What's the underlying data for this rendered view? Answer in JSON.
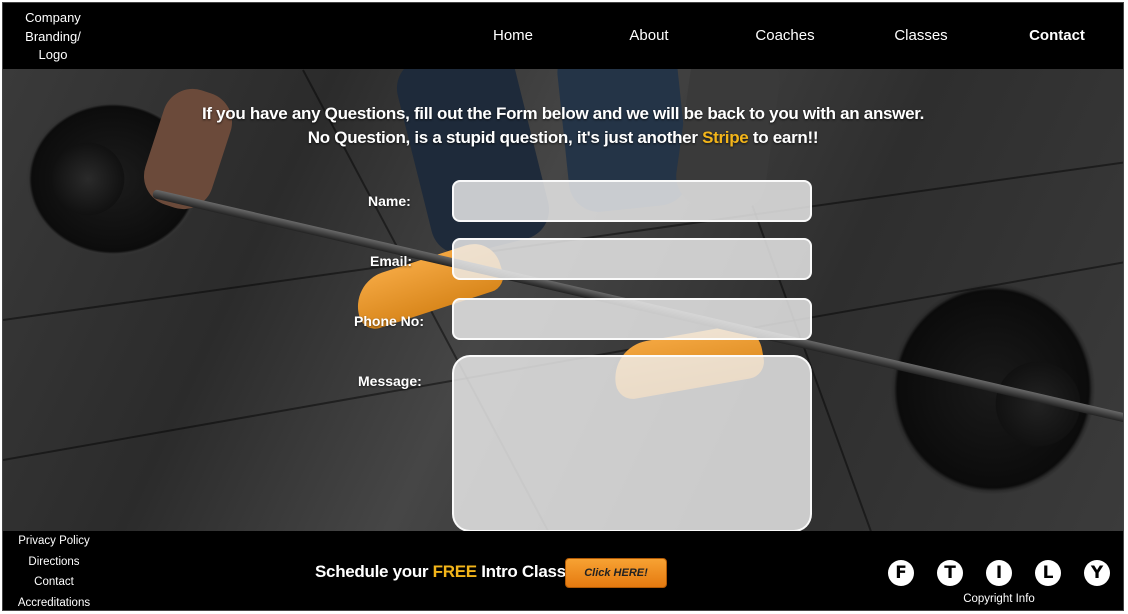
{
  "header": {
    "logo_line1": "Company",
    "logo_line2": "Branding/",
    "logo_line3": "Logo",
    "nav": {
      "home": "Home",
      "about": "About",
      "coaches": "Coaches",
      "classes": "Classes",
      "contact": "Contact"
    },
    "active_nav": "Contact"
  },
  "hero": {
    "line1": "If you have  any Questions, fill out the Form below and we will be back to you with an answer.",
    "line2_before": "No Question, is a stupid question, it's just another ",
    "line2_accent": "Stripe",
    "line2_after": " to earn!!"
  },
  "form": {
    "name_label": "Name:",
    "email_label": "Email:",
    "phone_label": "Phone No:",
    "message_label": "Message:",
    "name_value": "",
    "email_value": "",
    "phone_value": "",
    "message_value": ""
  },
  "footer": {
    "links": {
      "privacy": "Privacy Policy",
      "directions": "Directions",
      "contact": "Contact",
      "accreditations": "Accreditations"
    },
    "cta_before": "Schedule your ",
    "cta_accent": "FREE",
    "cta_after": " Intro Class:",
    "cta_button": "Click HERE!",
    "social": {
      "f": "F",
      "t": "T",
      "i": "I",
      "l": "L",
      "y": "Y"
    },
    "social_icons": [
      "facebook-icon",
      "twitter-icon",
      "instagram-icon",
      "linkedin-icon",
      "youtube-icon"
    ],
    "copyright": "Copyright Info"
  },
  "colors": {
    "accent": "#f3b51a",
    "cta_button": "#f08c1f",
    "background": "#000000"
  }
}
